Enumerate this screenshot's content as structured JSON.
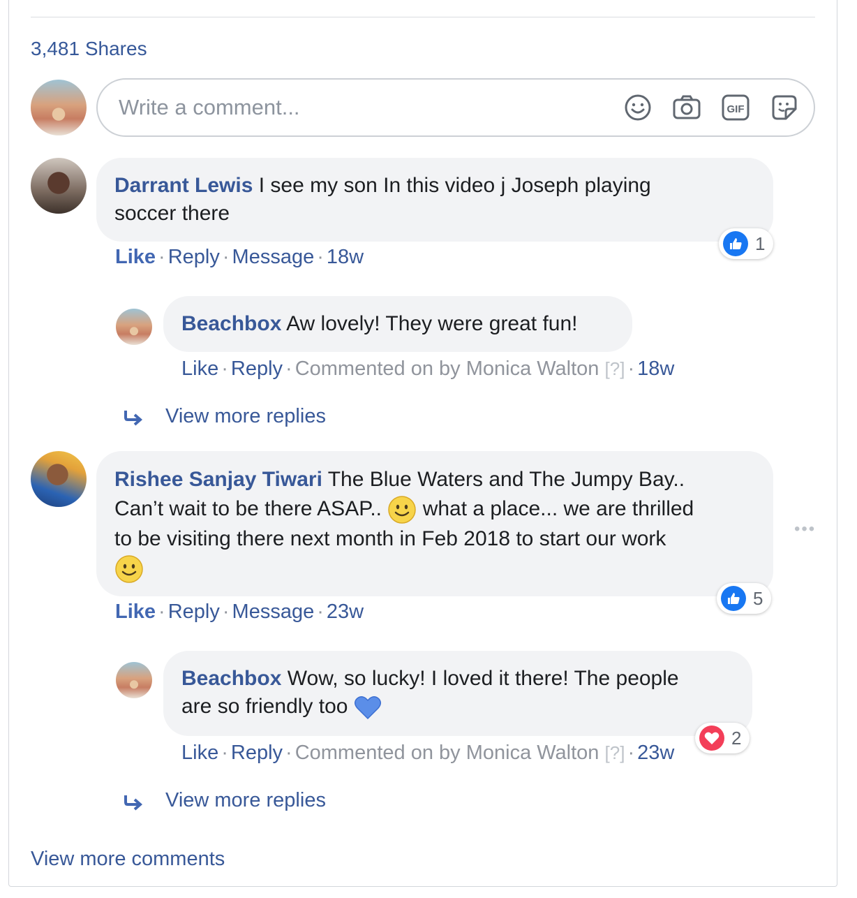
{
  "shares": "3,481 Shares",
  "composer": {
    "placeholder": "Write a comment...",
    "icons": [
      "smiley-icon",
      "camera-icon",
      "gif-icon",
      "sticker-icon"
    ],
    "gif_label": "GIF"
  },
  "comments": [
    {
      "author": "Darrant Lewis",
      "text_line1": "I see my son In this video j Joseph playing",
      "text_line2": "soccer there",
      "like": "Like",
      "reply": "Reply",
      "message": "Message",
      "time": "18w",
      "reaction_count": "1",
      "reply_item": {
        "author": "Beachbox",
        "text": "Aw lovely! They were great fun!",
        "like": "Like",
        "reply": "Reply",
        "commented_on": "Commented on by Monica Walton",
        "help": "[?]",
        "time": "18w"
      },
      "view_more": "View more replies"
    },
    {
      "author": "Rishee Sanjay Tiwari",
      "text_line1": "The Blue Waters and The Jumpy Bay..",
      "text_line2a": "Can’t wait to be there ASAP..",
      "text_line2b": "what a place... we are thrilled",
      "text_line3": "to be visiting there next month in Feb 2018 to start our work",
      "like": "Like",
      "reply": "Reply",
      "message": "Message",
      "time": "23w",
      "reaction_count": "5",
      "reply_item": {
        "author": "Beachbox",
        "text_line1": "Wow, so lucky! I loved it there! The people",
        "text_line2": "are so friendly too",
        "like": "Like",
        "reply": "Reply",
        "commented_on": "Commented on by Monica Walton",
        "help": "[?]",
        "time": "23w",
        "reaction_count": "2"
      },
      "view_more": "View more replies"
    }
  ],
  "view_more_comments": "View more comments",
  "more_options": "•••",
  "colors": {
    "link": "#385898",
    "like_blue": "#1877f2",
    "love_red": "#f33e58",
    "bubble": "#f2f3f5"
  }
}
